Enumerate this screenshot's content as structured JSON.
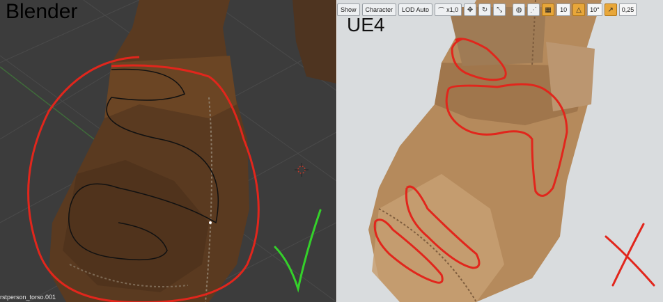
{
  "left_panel": {
    "label": "Blender",
    "object_name": "rstperson_torso.001",
    "colors": {
      "background": "#3c3c3c",
      "check_mark": "#34d12a",
      "outline": "#e1261c"
    }
  },
  "right_panel": {
    "label": "UE4",
    "toolbar": {
      "show": "Show",
      "character": "Character",
      "lod": "LOD Auto",
      "speed": "x1,0",
      "grid_snap": "10",
      "rotation_snap": "10°",
      "scale_snap": "0,25"
    },
    "colors": {
      "background": "#d9dcde",
      "cross_mark": "#e1261c",
      "accent": "#e8a73a"
    }
  }
}
